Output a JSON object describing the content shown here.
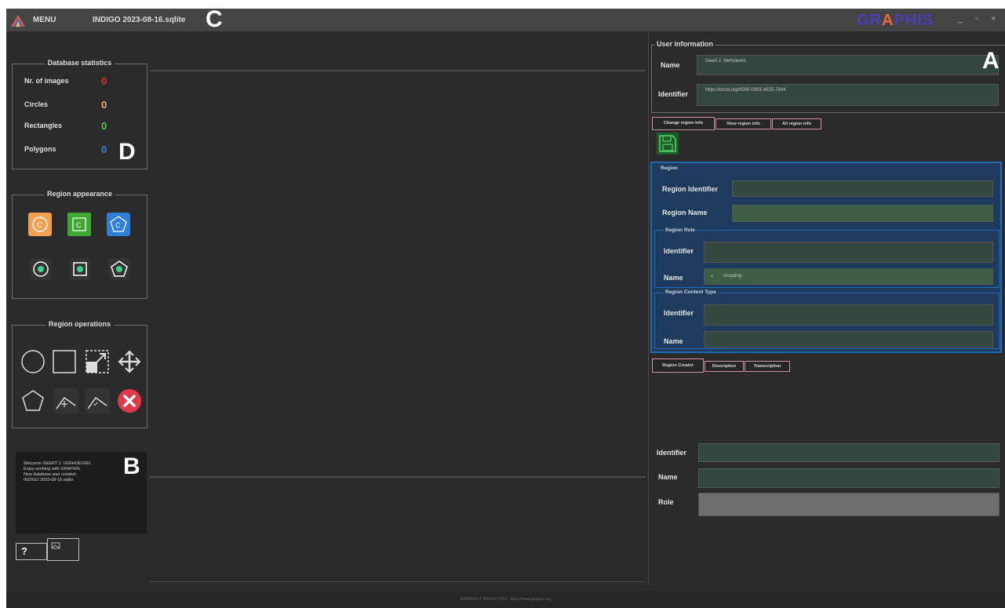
{
  "titlebar": {
    "menu_label": "MENU",
    "db_name": "INDIGO 2023-08-16.sqlite",
    "brand_a": "GR",
    "brand_b": "PHIS"
  },
  "annotations": {
    "A": "A",
    "B": "B",
    "C": "C",
    "D": "D"
  },
  "stats": {
    "title": "Database statistics",
    "rows": [
      {
        "label": "Nr. of images",
        "value": "0",
        "color": "#d8332b"
      },
      {
        "label": "Circles",
        "value": "0",
        "color": "#f0b070"
      },
      {
        "label": "Rectangles",
        "value": "0",
        "color": "#5ac04a"
      },
      {
        "label": "Polygons",
        "value": "0",
        "color": "#3c7fd8"
      }
    ]
  },
  "appearance": {
    "title": "Region appearance"
  },
  "operations": {
    "title": "Region operations"
  },
  "messages": {
    "lines": [
      "Welcome GEERT J. VERHOEVEN.",
      "Enjoy working with GRAPHIS.",
      "New database was created:",
      "INDIGO 2023-08-16.sqlite"
    ]
  },
  "help_button": "?",
  "user": {
    "title": "User information",
    "name_label": "Name",
    "name_value": "Geert J. Verhoeven",
    "identifier_label": "Identifier",
    "identifier_value": "https://orcid.org/0000-0003-4025-7844"
  },
  "tabs_top": [
    "Change region info",
    "View region info",
    "All region info"
  ],
  "region": {
    "title": "Region",
    "identifier_label": "Region Identifier",
    "name_label": "Region Name",
    "role": {
      "title": "Region Role",
      "identifier_label": "Identifier",
      "name_label": "Name",
      "name_value": "cropping"
    },
    "content_type": {
      "title": "Region Content Type",
      "identifier_label": "Identifier",
      "name_label": "Name"
    }
  },
  "tabs_bottom": [
    "Region Creator",
    "Description",
    "Transcription"
  ],
  "creator": {
    "identifier_label": "Identifier",
    "name_label": "Name",
    "role_label": "Role"
  },
  "footer": "GRAPHIS ©  INDIGO 2023 · https://www.graphis.org",
  "colors": {
    "accent_blue": "#1f6bb8",
    "field_green": "#35483f",
    "tab_border": "#d08eaa",
    "delete_red": "#e0394a"
  }
}
